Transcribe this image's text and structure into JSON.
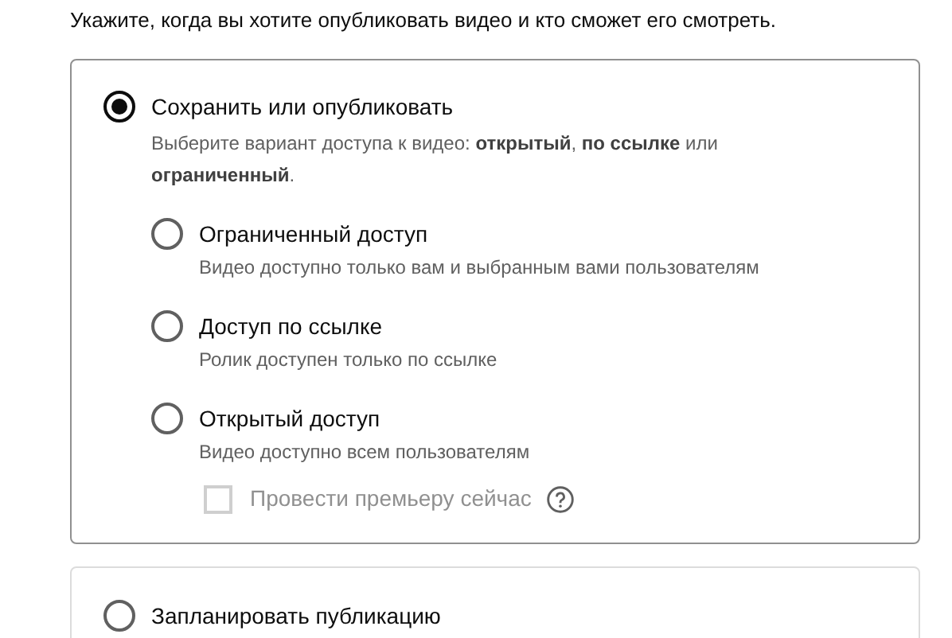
{
  "subtitle": "Укажите, когда вы хотите опубликовать видео и кто сможет его смотреть.",
  "options": [
    {
      "label": "Сохранить или опубликовать",
      "selected": true,
      "description": "Выберите вариант доступа к видео: **открытый**, **по ссылке** или **ограниченный**.",
      "visibility": [
        {
          "label": "Ограниченный доступ",
          "selected": false,
          "description": "Видео доступно только вам и выбранным вами пользователям"
        },
        {
          "label": "Доступ по ссылке",
          "selected": false,
          "description": "Ролик доступен только по ссылке"
        },
        {
          "label": "Открытый доступ",
          "selected": false,
          "description": "Видео доступно всем пользователям"
        }
      ],
      "premiere": {
        "label": "Провести премьеру сейчас",
        "checked": false,
        "disabled": true
      }
    },
    {
      "label": "Запланировать публикацию",
      "selected": false
    }
  ]
}
